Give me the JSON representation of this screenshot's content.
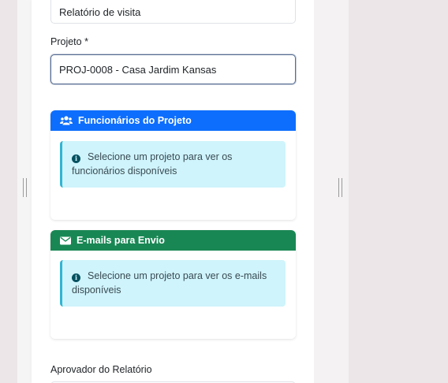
{
  "form": {
    "report_name_value": "Relatório de visita",
    "project_label": "Projeto *",
    "project_value": "PROJ-0008 - Casa Jardim Kansas",
    "approver_label": "Aprovador do Relatório"
  },
  "employees_card": {
    "title": "Funcionários do Projeto",
    "icon": "users-icon",
    "header_color": "#0d6efd",
    "alert_text": "Selecione um projeto para ver os funcionários disponíveis"
  },
  "emails_card": {
    "title": "E-mails para Envio",
    "icon": "envelope-icon",
    "header_color": "#198754",
    "alert_text": "Selecione um projeto para ver os e-mails disponíveis"
  },
  "info_icon": "i"
}
